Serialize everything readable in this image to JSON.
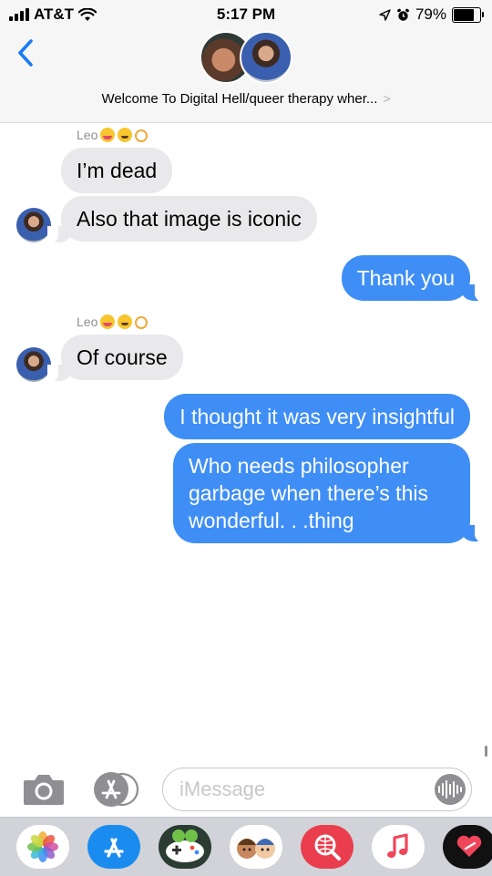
{
  "status_bar": {
    "carrier": "AT&T",
    "time": "5:17 PM",
    "battery_percent": "79%",
    "battery_level": 0.79,
    "icons": [
      "signal-bars-icon",
      "wifi-icon",
      "location-arrow-icon",
      "alarm-icon",
      "battery-icon"
    ]
  },
  "header": {
    "back_icon": "chevron-left-icon",
    "group_name": "Welcome To Digital Hell/queer therapy wher...",
    "group_chevron": ">"
  },
  "messages": [
    {
      "sender": "Leo",
      "direction": "incoming"
    },
    {
      "text": "I’m dead",
      "direction": "incoming"
    },
    {
      "text": "Also that image is iconic",
      "direction": "incoming"
    },
    {
      "text": "Thank you",
      "direction": "outgoing"
    },
    {
      "sender": "Leo",
      "direction": "incoming"
    },
    {
      "text": "Of course",
      "direction": "incoming"
    },
    {
      "text": "I thought it was very insightful",
      "direction": "outgoing"
    },
    {
      "lines": [
        "Who needs philosopher",
        "garbage when there’s this",
        "wonderful. . .thing"
      ],
      "direction": "outgoing"
    }
  ],
  "composer": {
    "placeholder": "iMessage",
    "value": "",
    "icons": [
      "camera-icon",
      "app-store-icon",
      "audio-waveform-icon"
    ]
  },
  "app_drawer": {
    "apps": [
      "photos-app-icon",
      "app-store-app-icon",
      "game-controller-app-icon",
      "memoji-app-icon",
      "web-search-app-icon",
      "music-app-icon",
      "digital-touch-app-icon"
    ]
  },
  "colors": {
    "outgoing_bubble": "#3f8ef5",
    "incoming_bubble": "#e9e9eb",
    "accent": "#1a7cf5"
  }
}
